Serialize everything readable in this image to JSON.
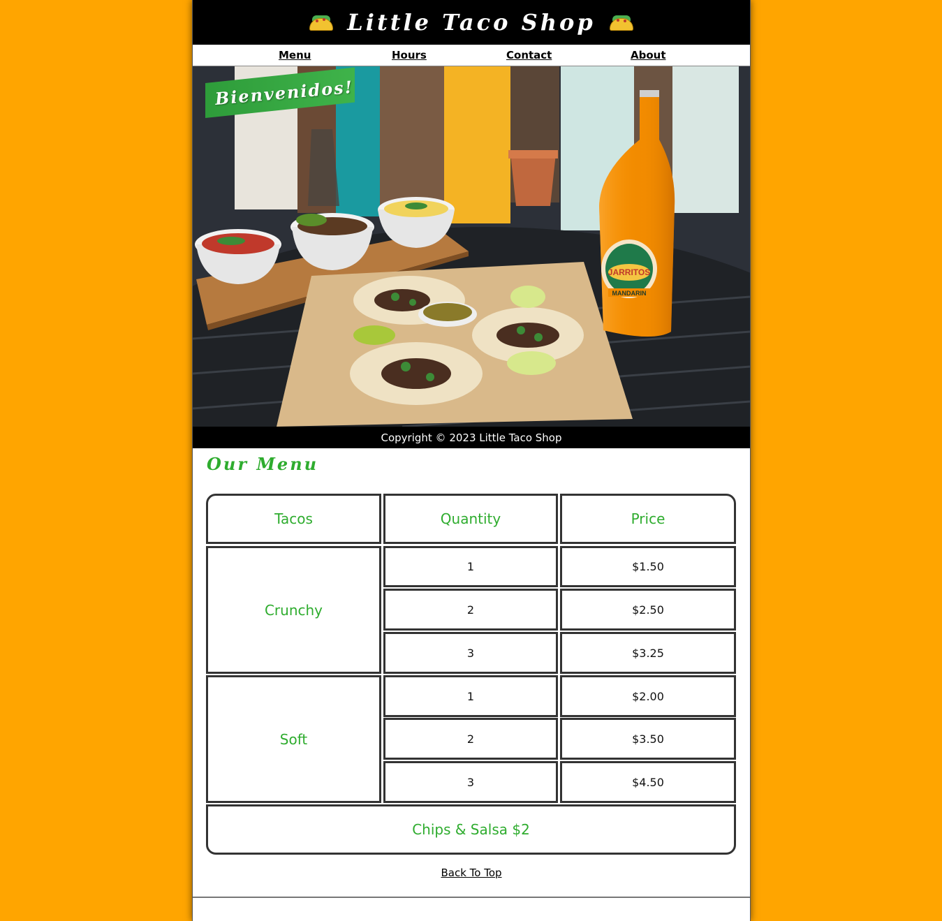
{
  "colors": {
    "page_background": "#FFA500",
    "accent_green": "#2eac2e",
    "header_background": "#000000"
  },
  "header": {
    "title": "Little Taco Shop",
    "left_icon": "taco-icon",
    "right_icon": "taco-icon"
  },
  "nav": {
    "items": [
      {
        "label": "Menu"
      },
      {
        "label": "Hours"
      },
      {
        "label": "Contact"
      },
      {
        "label": "About"
      }
    ]
  },
  "hero": {
    "banner_text": "Bienvenidos!",
    "image_subject": "tacos-and-jarritos-photo",
    "bottle_label": "JARRITOS",
    "bottle_flavor": "MANDARIN"
  },
  "footer": {
    "copyright": "Copyright © 2023 Little Taco Shop"
  },
  "menu": {
    "title": "Our Menu",
    "headers": [
      "Tacos",
      "Quantity",
      "Price"
    ],
    "groups": [
      {
        "name": "Crunchy",
        "rows": [
          {
            "quantity": "1",
            "price": "$1.50"
          },
          {
            "quantity": "2",
            "price": "$2.50"
          },
          {
            "quantity": "3",
            "price": "$3.25"
          }
        ]
      },
      {
        "name": "Soft",
        "rows": [
          {
            "quantity": "1",
            "price": "$2.00"
          },
          {
            "quantity": "2",
            "price": "$3.50"
          },
          {
            "quantity": "3",
            "price": "$4.50"
          }
        ]
      }
    ],
    "extra": "Chips & Salsa $2"
  },
  "back_to_top": "Back To Top"
}
